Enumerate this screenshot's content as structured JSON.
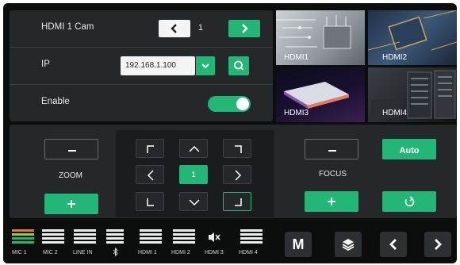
{
  "camera": {
    "label": "HDMI 1 Cam",
    "number": "1"
  },
  "ip": {
    "label": "IP",
    "value": "192.168.1.100"
  },
  "enable": {
    "label": "Enable",
    "on": true
  },
  "previews": [
    {
      "label": "HDMI1"
    },
    {
      "label": "HDMI2"
    },
    {
      "label": "HDMI3"
    },
    {
      "label": "HDMI4"
    }
  ],
  "zoom": {
    "label": "ZOOM",
    "minus": "−",
    "plus": "+"
  },
  "ptz": {
    "center": "1"
  },
  "focus": {
    "label": "FOCUS",
    "minus": "−",
    "plus": "+",
    "auto": "Auto"
  },
  "channels": [
    {
      "label": "MIC 1"
    },
    {
      "label": "MIC 2"
    },
    {
      "label": "LINE IN"
    },
    {
      "label": ""
    },
    {
      "label": "HDMI 1"
    },
    {
      "label": "HDMI 2"
    },
    {
      "label": "HDMI 3"
    },
    {
      "label": "HDMI 4"
    }
  ],
  "menu": {
    "m_label": "M"
  },
  "colors": {
    "accent": "#22b776",
    "panel": "#25282b",
    "background": "#0c0d0d"
  },
  "icons": [
    "chevron-left-icon",
    "chevron-right-icon",
    "chevron-down-icon",
    "search-icon",
    "refresh-icon",
    "bluetooth-icon",
    "speaker-muted-icon",
    "layers-icon"
  ]
}
